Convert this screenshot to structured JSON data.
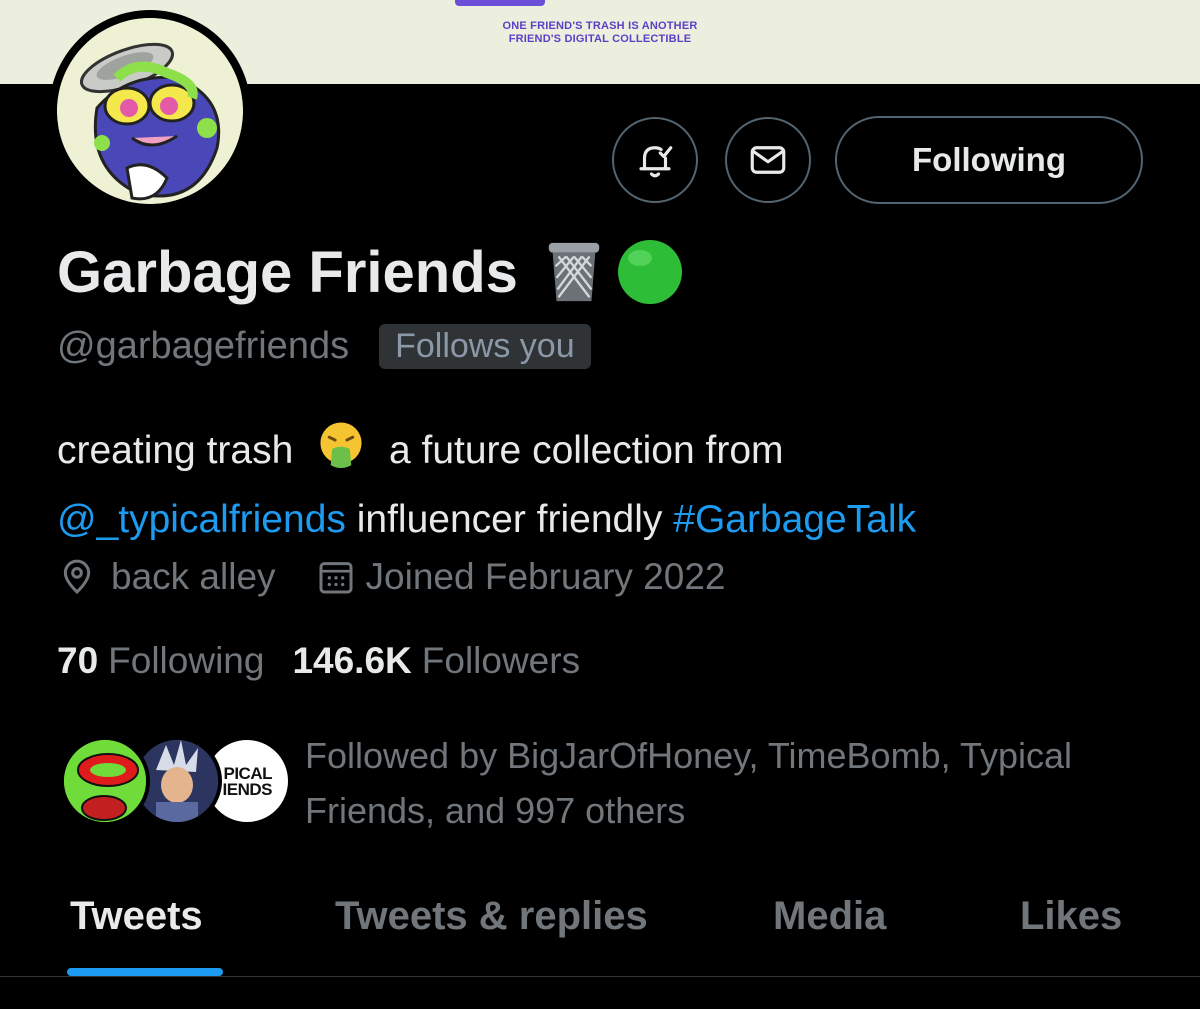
{
  "banner": {
    "tagline_1": "ONE FRIEND'S TRASH IS ANOTHER",
    "tagline_2": "FRIEND'S DIGITAL COLLECTIBLE"
  },
  "profile": {
    "name": "Garbage Friends",
    "name_emojis": [
      "🗑️",
      "🟢"
    ],
    "handle": "@garbagefriends",
    "follows_you": "Follows you",
    "bio": {
      "part1": "creating trash",
      "emoji": "🤮",
      "part2": "a future collection from",
      "mention": "@_typicalfriends",
      "part3": "influencer friendly",
      "hashtag": "#GarbageTalk"
    },
    "location": "back alley",
    "joined": "Joined February 2022",
    "following_count": "70",
    "following_label": "Following",
    "followers_count": "146.6K",
    "followers_label": "Followers",
    "followed_by": "Followed by BigJarOfHoney, TimeBomb, Typical Friends, and 997 others",
    "follower_avatar_text": [
      "PICAL",
      "IENDS"
    ]
  },
  "actions": {
    "follow_label": "Following",
    "notify_icon": "bell-check-icon",
    "message_icon": "mail-icon"
  },
  "tabs": [
    {
      "label": "Tweets"
    },
    {
      "label": "Tweets & replies"
    },
    {
      "label": "Media"
    },
    {
      "label": "Likes"
    }
  ],
  "colors": {
    "accent": "#1d9bf0",
    "muted": "#71767b",
    "background": "#000000"
  }
}
